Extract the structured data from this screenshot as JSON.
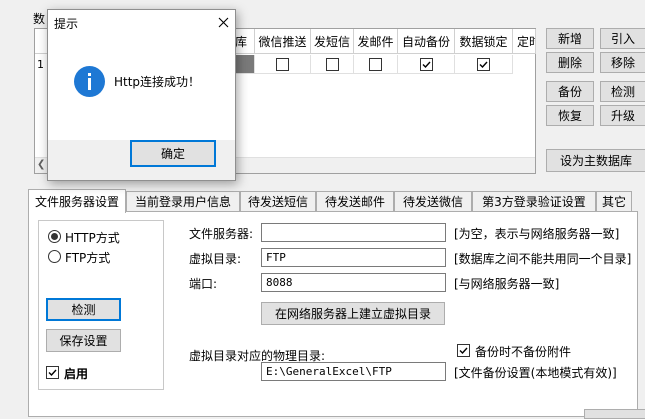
{
  "grid": {
    "partial_label": "数",
    "headers": [
      "库",
      "微信推送",
      "发短信",
      "发邮件",
      "自动备份",
      "数据锁定",
      "定时"
    ],
    "row_num": "1",
    "row_checks": [
      false,
      false,
      false,
      true,
      true
    ]
  },
  "side_buttons": {
    "add": "新增",
    "import": "引入",
    "delete": "删除",
    "remove": "移除",
    "backup": "备份",
    "detect": "检测",
    "restore": "恢复",
    "upgrade": "升级",
    "set_main": "设为主数据库"
  },
  "tabs": [
    "文件服务器设置",
    "当前登录用户信息",
    "待发送短信",
    "待发送邮件",
    "待发送微信",
    "第3方登录验证设置",
    "其它"
  ],
  "panel": {
    "http_mode": "HTTP方式",
    "ftp_mode": "FTP方式",
    "selected_mode": "HTTP",
    "detect_btn": "检测",
    "save_btn": "保存设置",
    "enable_label": "启用",
    "enabled": true,
    "file_server_label": "文件服务器:",
    "file_server_value": "",
    "file_server_hint": "[为空，表示与网络服务器一致]",
    "vdir_label": "虚拟目录:",
    "vdir_value": "FTP",
    "vdir_hint": "[数据库之间不能共用同一个目录]",
    "port_label": "端口:",
    "port_value": "8088",
    "port_hint": "[与网络服务器一致]",
    "create_vdir_btn": "在网络服务器上建立虚拟目录",
    "no_backup_attach": "备份时不备份附件",
    "no_backup_checked": true,
    "phys_dir_label": "虚拟目录对应的物理目录:",
    "phys_dir_value": "E:\\GeneralExcel\\FTP",
    "phys_dir_hint": "[文件备份设置(本地模式有效)]"
  },
  "dialog": {
    "title": "提示",
    "message": "Http连接成功！",
    "ok": "确定"
  },
  "colors": {
    "info_icon": "#1e78d4",
    "focus": "#0078d7"
  }
}
